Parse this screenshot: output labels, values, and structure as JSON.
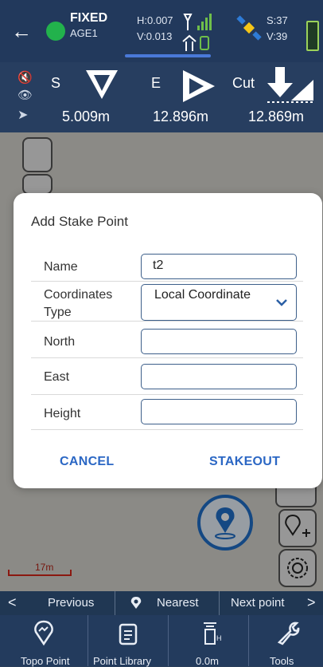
{
  "status": {
    "fix": "FIXED",
    "age": "AGE1",
    "h": "H:0.007",
    "v": "V:0.013",
    "sats_s": "S:37",
    "sats_v": "V:39"
  },
  "stake": {
    "north_dir": "S",
    "north_val": "5.009m",
    "east_dir": "E",
    "east_val": "12.896m",
    "height_dir": "Cut",
    "height_val": "12.869m"
  },
  "map": {
    "scale": "17m"
  },
  "dialog": {
    "title": "Add Stake Point",
    "rows": [
      {
        "label": "Name",
        "value": "t2"
      },
      {
        "label": "Coordinates Type",
        "value": "Local Coordinate"
      },
      {
        "label": "North",
        "value": ""
      },
      {
        "label": "East",
        "value": ""
      },
      {
        "label": "Height",
        "value": ""
      }
    ],
    "cancel": "CANCEL",
    "stakeout": "STAKEOUT"
  },
  "nav": {
    "previous": "Previous",
    "nearest": "Nearest",
    "next": "Next point"
  },
  "bottom": {
    "items": [
      "Topo Point",
      "Point Library",
      "0.0m",
      "Tools"
    ]
  },
  "colors": {
    "accent": "#2b67c4",
    "fixed": "#22b24c",
    "bar": "#22395c"
  }
}
